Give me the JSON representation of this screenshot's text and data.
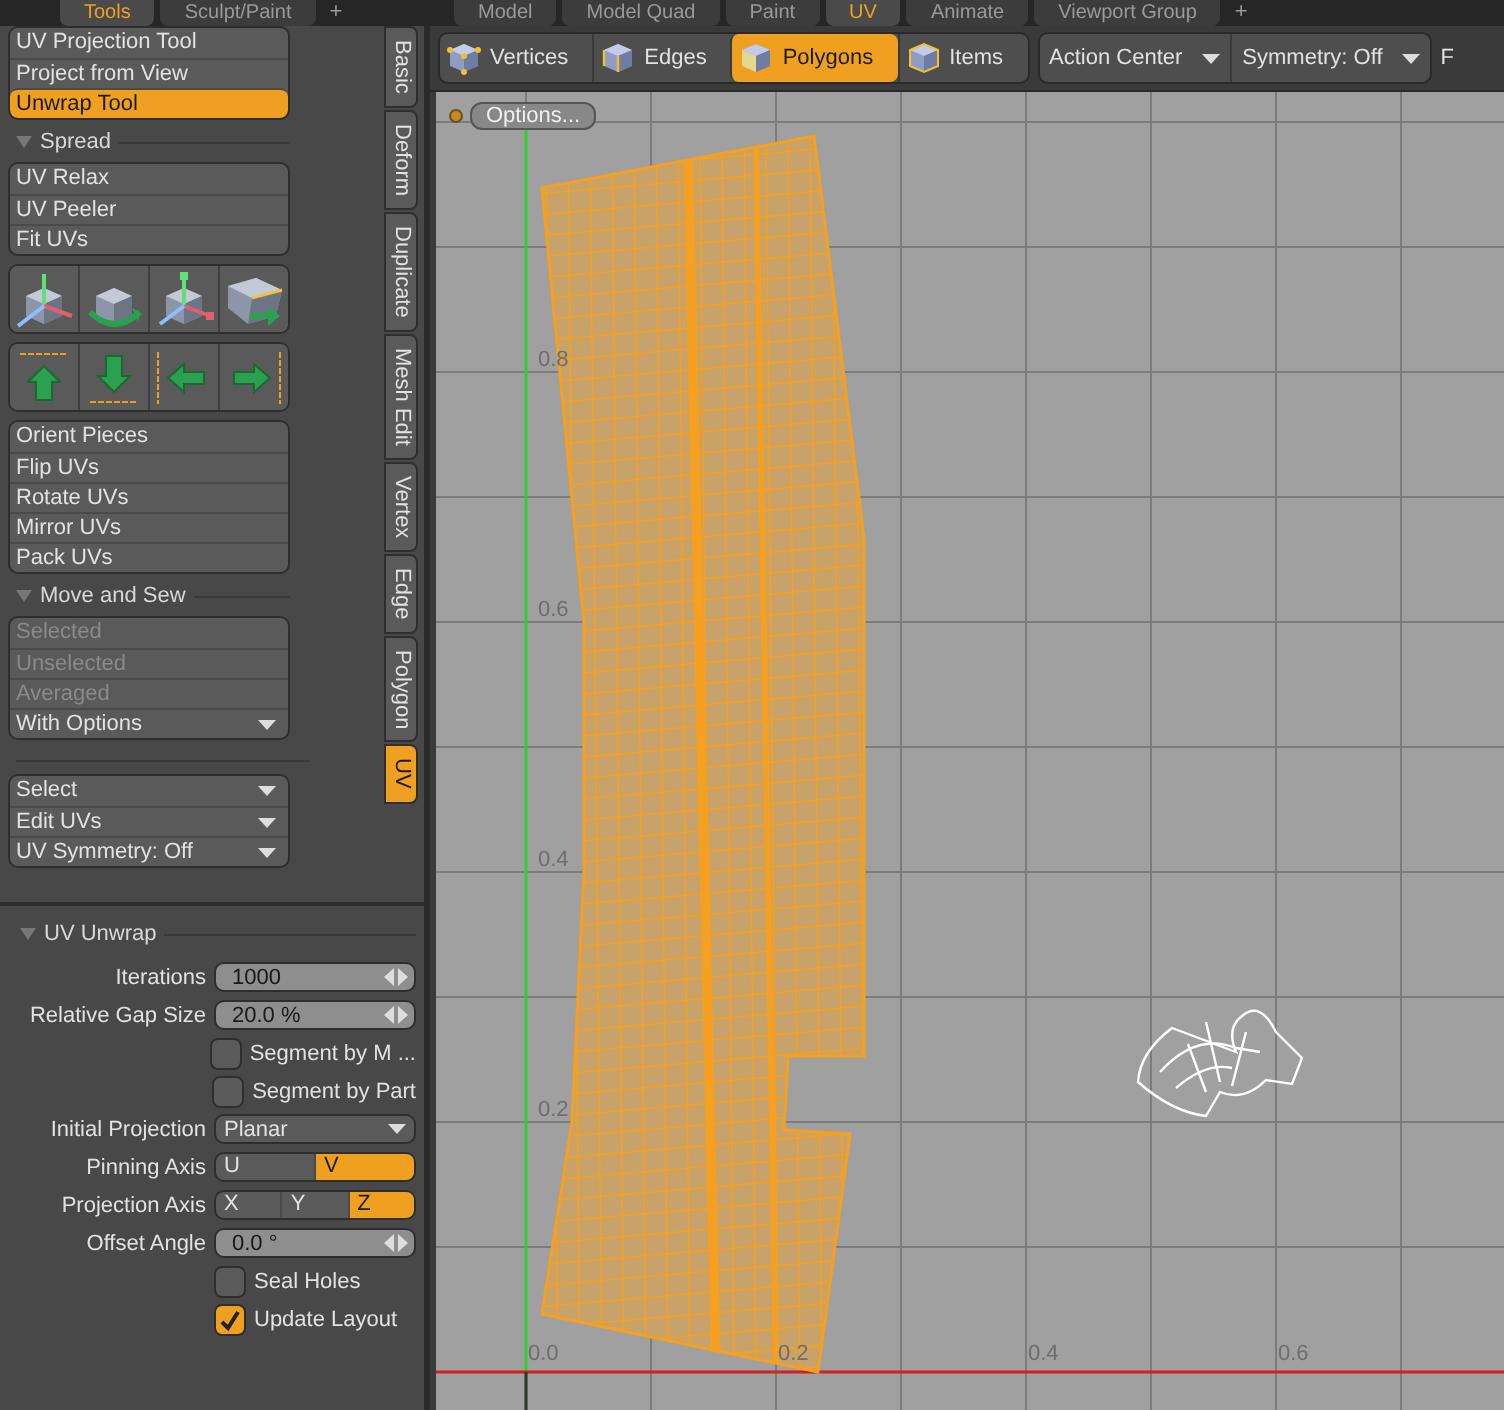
{
  "top_tabs_left": [
    {
      "label": "Tools",
      "selected": true
    },
    {
      "label": "Sculpt/Paint",
      "selected": false
    }
  ],
  "top_tabs_left_add": "+",
  "top_tabs_right": [
    {
      "label": "Model",
      "selected": false
    },
    {
      "label": "Model Quad",
      "selected": false
    },
    {
      "label": "Paint",
      "selected": false
    },
    {
      "label": "UV",
      "selected": true
    },
    {
      "label": "Animate",
      "selected": false
    },
    {
      "label": "Viewport Group",
      "selected": false
    }
  ],
  "top_tabs_right_add": "+",
  "tool_panel": [
    {
      "kind": "buttons",
      "items": [
        {
          "label": "UV Projection Tool",
          "selected": false,
          "disabled": false,
          "dropdown": false
        },
        {
          "label": "Project from View",
          "selected": false,
          "disabled": false,
          "dropdown": false
        },
        {
          "label": "Unwrap Tool",
          "selected": true,
          "disabled": false,
          "dropdown": false
        }
      ]
    },
    {
      "kind": "header",
      "label": "Spread"
    },
    {
      "kind": "buttons",
      "items": [
        {
          "label": "UV Relax",
          "selected": false,
          "disabled": false,
          "dropdown": false
        },
        {
          "label": "UV Peeler",
          "selected": false,
          "disabled": false,
          "dropdown": false
        },
        {
          "label": "Fit UVs",
          "selected": false,
          "disabled": false,
          "dropdown": false
        }
      ]
    },
    {
      "kind": "icons",
      "items": [
        {
          "kind": "cube-axes"
        },
        {
          "kind": "cube-rotate"
        },
        {
          "kind": "cube-move"
        },
        {
          "kind": "cube-slant"
        }
      ]
    },
    {
      "kind": "icons",
      "items": [
        {
          "kind": "arrow-up"
        },
        {
          "kind": "arrow-down"
        },
        {
          "kind": "arrow-left"
        },
        {
          "kind": "arrow-right"
        }
      ]
    },
    {
      "kind": "buttons",
      "items": [
        {
          "label": "Orient Pieces",
          "selected": false,
          "disabled": false,
          "dropdown": false
        },
        {
          "label": "Flip UVs",
          "selected": false,
          "disabled": false,
          "dropdown": false
        },
        {
          "label": "Rotate UVs",
          "selected": false,
          "disabled": false,
          "dropdown": false
        },
        {
          "label": "Mirror UVs",
          "selected": false,
          "disabled": false,
          "dropdown": false
        },
        {
          "label": "Pack UVs",
          "selected": false,
          "disabled": false,
          "dropdown": false
        }
      ]
    },
    {
      "kind": "header",
      "label": "Move and Sew"
    },
    {
      "kind": "buttons",
      "items": [
        {
          "label": "Selected",
          "selected": false,
          "disabled": true,
          "dropdown": false
        },
        {
          "label": "Unselected",
          "selected": false,
          "disabled": true,
          "dropdown": false
        },
        {
          "label": "Averaged",
          "selected": false,
          "disabled": true,
          "dropdown": false
        },
        {
          "label": "With Options",
          "selected": false,
          "disabled": false,
          "dropdown": true
        }
      ]
    },
    {
      "kind": "divider"
    },
    {
      "kind": "buttons",
      "items": [
        {
          "label": "Select",
          "selected": false,
          "disabled": false,
          "dropdown": true
        },
        {
          "label": "Edit UVs",
          "selected": false,
          "disabled": false,
          "dropdown": true
        },
        {
          "label": "UV Symmetry: Off",
          "selected": false,
          "disabled": false,
          "dropdown": true
        }
      ]
    }
  ],
  "side_tabs": [
    {
      "label": "Basic",
      "selected": false
    },
    {
      "label": "Deform",
      "selected": false
    },
    {
      "label": "Duplicate",
      "selected": false
    },
    {
      "label": "Mesh Edit",
      "selected": false
    },
    {
      "label": "Vertex",
      "selected": false
    },
    {
      "label": "Edge",
      "selected": false
    },
    {
      "label": "Polygon",
      "selected": false
    },
    {
      "label": "UV",
      "selected": true
    }
  ],
  "properties": {
    "title": "UV Unwrap",
    "rows": [
      {
        "kind": "number",
        "label": "Iterations",
        "value": "1000"
      },
      {
        "kind": "number",
        "label": "Relative Gap Size",
        "value": "20.0 %"
      },
      {
        "kind": "checkbox",
        "label": "Segment by M ...",
        "checked": false
      },
      {
        "kind": "checkbox",
        "label": "Segment by Part",
        "checked": false
      },
      {
        "kind": "dropdown",
        "label": "Initial Projection",
        "value": "Planar"
      },
      {
        "kind": "segmented",
        "label": "Pinning Axis",
        "options": [
          {
            "label": "U",
            "selected": false
          },
          {
            "label": "V",
            "selected": true
          }
        ]
      },
      {
        "kind": "segmented",
        "label": "Projection Axis",
        "options": [
          {
            "label": "X",
            "selected": false
          },
          {
            "label": "Y",
            "selected": false
          },
          {
            "label": "Z",
            "selected": true
          }
        ]
      },
      {
        "kind": "number",
        "label": "Offset Angle",
        "value": "0.0 °"
      },
      {
        "kind": "checkbox",
        "label": "Seal Holes",
        "checked": false
      },
      {
        "kind": "checkbox",
        "label": "Update Layout",
        "checked": true
      }
    ]
  },
  "toolbar": {
    "modes": [
      {
        "label": "Vertices",
        "kind": "vertices",
        "selected": false
      },
      {
        "label": "Edges",
        "kind": "edges",
        "selected": false
      },
      {
        "label": "Polygons",
        "kind": "polygons",
        "selected": true
      },
      {
        "label": "Items",
        "kind": "items",
        "selected": false
      }
    ],
    "dropdowns": [
      "Action Center",
      "Symmetry: Off"
    ],
    "cut_label": "F"
  },
  "viewport": {
    "options_button": "Options...",
    "y_labels": [
      "0.8",
      "0.6",
      "0.4",
      "0.2"
    ],
    "x_labels": [
      "0.0",
      "0.2",
      "0.4",
      "0.6"
    ]
  }
}
